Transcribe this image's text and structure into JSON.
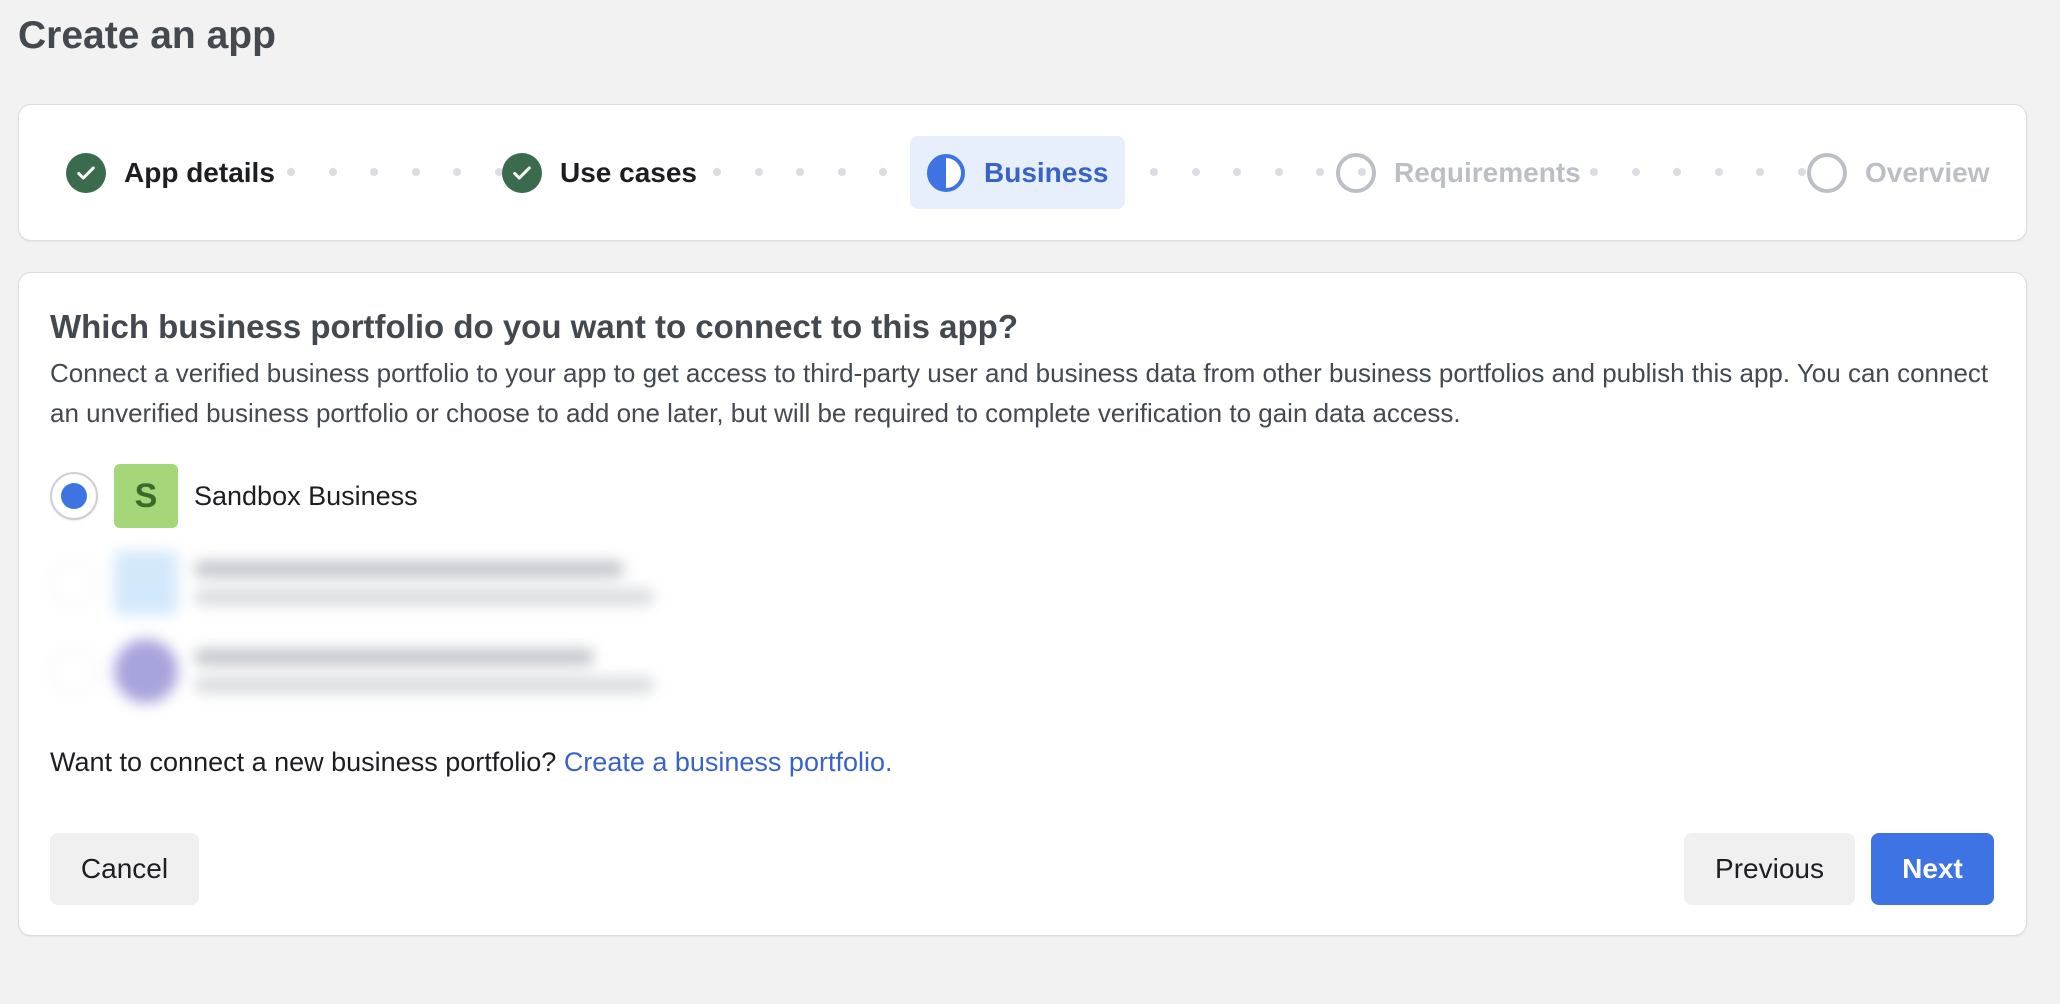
{
  "page": {
    "title": "Create an app"
  },
  "stepper": {
    "steps": [
      {
        "label": "App details",
        "state": "completed"
      },
      {
        "label": "Use cases",
        "state": "completed"
      },
      {
        "label": "Business",
        "state": "current"
      },
      {
        "label": "Requirements",
        "state": "upcoming"
      },
      {
        "label": "Overview",
        "state": "upcoming"
      }
    ]
  },
  "business": {
    "question": "Which business portfolio do you want to connect to this app?",
    "description": "Connect a verified business portfolio to your app to get access to third-party user and business data from other business portfolios and publish this app. You can connect an unverified business portfolio or choose to add one later, but will be required to complete verification to gain data access.",
    "options": [
      {
        "name": "Sandbox Business",
        "initial": "S",
        "selected": true,
        "avatar_bg": "#a4d67a",
        "avatar_fg": "#3a6b2a"
      }
    ],
    "connect_prompt": "Want to connect a new business portfolio?",
    "connect_link": "Create a business portfolio."
  },
  "actions": {
    "cancel": "Cancel",
    "previous": "Previous",
    "next": "Next"
  },
  "colors": {
    "accent": "#3e73e4",
    "link": "#3a63c9",
    "done": "#3a6b4c",
    "upcoming": "#bcc0c4"
  }
}
